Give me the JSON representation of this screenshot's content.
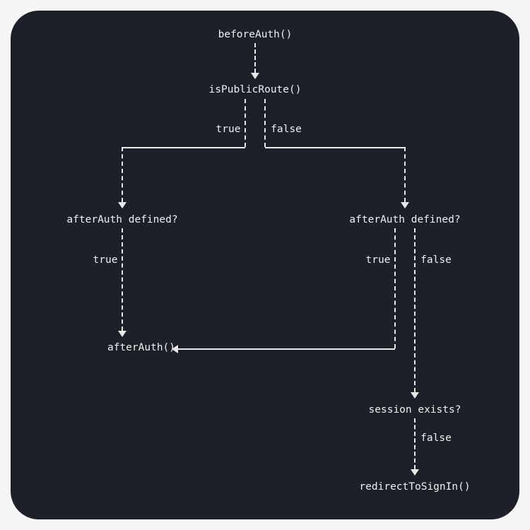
{
  "diagram": {
    "nodes": {
      "beforeAuth": "beforeAuth()",
      "isPublicRoute": "isPublicRoute()",
      "afterAuthDefinedLeft": "afterAuth defined?",
      "afterAuthDefinedRight": "afterAuth defined?",
      "afterAuth": "afterAuth()",
      "sessionExists": "session exists?",
      "redirectToSignIn": "redirectToSignIn()"
    },
    "edges": {
      "isPublicRouteTrue": "true",
      "isPublicRouteFalse": "false",
      "afterAuthLeftTrue": "true",
      "afterAuthRightTrue": "true",
      "afterAuthRightFalse": "false",
      "sessionExistsFalse": "false"
    },
    "flow": [
      {
        "from": "beforeAuth",
        "to": "isPublicRoute"
      },
      {
        "from": "isPublicRoute",
        "branch": "true",
        "to": "afterAuthDefinedLeft"
      },
      {
        "from": "isPublicRoute",
        "branch": "false",
        "to": "afterAuthDefinedRight"
      },
      {
        "from": "afterAuthDefinedLeft",
        "branch": "true",
        "to": "afterAuth"
      },
      {
        "from": "afterAuthDefinedRight",
        "branch": "true",
        "to": "afterAuth"
      },
      {
        "from": "afterAuthDefinedRight",
        "branch": "false",
        "to": "sessionExists"
      },
      {
        "from": "sessionExists",
        "branch": "false",
        "to": "redirectToSignIn"
      }
    ]
  }
}
